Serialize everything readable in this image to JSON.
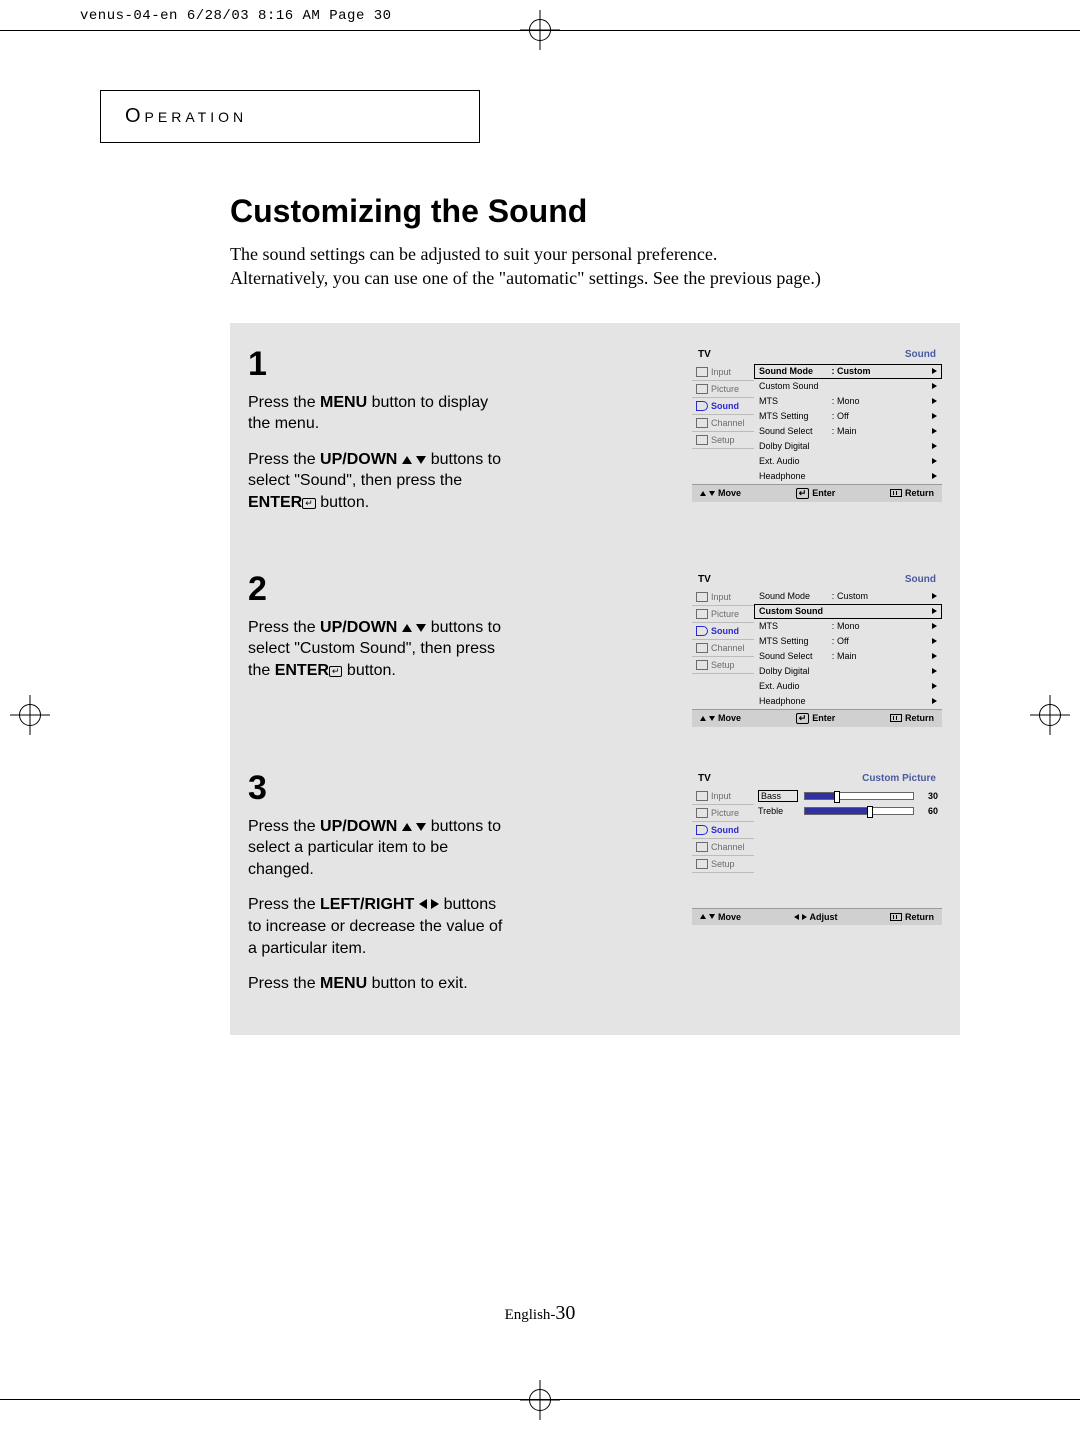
{
  "slug": "venus-04-en  6/28/03 8:16 AM  Page 30",
  "section": "Operation",
  "title": "Customizing the Sound",
  "lead1": "The sound settings can be adjusted to suit your personal preference.",
  "lead2": "Alternatively, you can use one of the \"automatic\" settings. See the previous page.)",
  "steps": {
    "s1": {
      "num": "1",
      "p1a": "Press the ",
      "p1b": "MENU",
      "p1c": " button to display the menu.",
      "p2a": "Press the ",
      "p2b": "UP/DOWN",
      "p2c": " buttons to select \"Sound\", then press the ",
      "p2d": "ENTER",
      "p2e": " button."
    },
    "s2": {
      "num": "2",
      "p1a": "Press the ",
      "p1b": "UP/DOWN",
      "p1c": " buttons to select \"Custom Sound\", then press the ",
      "p1d": "ENTER",
      "p1e": " button."
    },
    "s3": {
      "num": "3",
      "p1a": "Press the ",
      "p1b": "UP/DOWN",
      "p1c": " buttons to select a particular item to be changed.",
      "p2a": "Press the ",
      "p2b": "LEFT/RIGHT",
      "p2c": " buttons to increase or decrease the value of a particular item.",
      "p3a": "Press the ",
      "p3b": "MENU",
      "p3c": " button to exit."
    }
  },
  "osd_side": {
    "tv": "TV",
    "items": [
      "Input",
      "Picture",
      "Sound",
      "Channel",
      "Setup"
    ]
  },
  "osd1": {
    "title": "Sound",
    "active_side": "Sound",
    "rows": [
      {
        "k": "Sound Mode",
        "c": ":",
        "v": "Custom",
        "sel": true
      },
      {
        "k": "Custom Sound",
        "c": "",
        "v": "",
        "sel": false
      },
      {
        "k": "MTS",
        "c": ":",
        "v": "Mono",
        "sel": false
      },
      {
        "k": "MTS Setting",
        "c": ":",
        "v": "Off",
        "sel": false
      },
      {
        "k": "Sound Select",
        "c": ":",
        "v": "Main",
        "sel": false
      },
      {
        "k": "Dolby Digital",
        "c": "",
        "v": "",
        "sel": false
      },
      {
        "k": "Ext. Audio",
        "c": "",
        "v": "",
        "sel": false
      },
      {
        "k": "Headphone",
        "c": "",
        "v": "",
        "sel": false
      }
    ],
    "foot": {
      "move": "Move",
      "enter": "Enter",
      "ret": "Return"
    }
  },
  "osd2": {
    "title": "Sound",
    "active_side": "Sound",
    "rows": [
      {
        "k": "Sound Mode",
        "c": ":",
        "v": "Custom",
        "sel": false
      },
      {
        "k": "Custom Sound",
        "c": "",
        "v": "",
        "sel": true
      },
      {
        "k": "MTS",
        "c": ":",
        "v": "Mono",
        "sel": false
      },
      {
        "k": "MTS Setting",
        "c": ":",
        "v": "Off",
        "sel": false
      },
      {
        "k": "Sound Select",
        "c": ":",
        "v": "Main",
        "sel": false
      },
      {
        "k": "Dolby Digital",
        "c": "",
        "v": "",
        "sel": false
      },
      {
        "k": "Ext. Audio",
        "c": "",
        "v": "",
        "sel": false
      },
      {
        "k": "Headphone",
        "c": "",
        "v": "",
        "sel": false
      }
    ],
    "foot": {
      "move": "Move",
      "enter": "Enter",
      "ret": "Return"
    }
  },
  "osd3": {
    "title": "Custom Picture",
    "active_side": "Sound",
    "sliders": [
      {
        "lab": "Bass",
        "val": 30,
        "sel": true
      },
      {
        "lab": "Treble",
        "val": 60,
        "sel": false
      }
    ],
    "foot": {
      "move": "Move",
      "adjust": "Adjust",
      "ret": "Return"
    }
  },
  "footer": {
    "lang": "English-",
    "page": "30"
  }
}
